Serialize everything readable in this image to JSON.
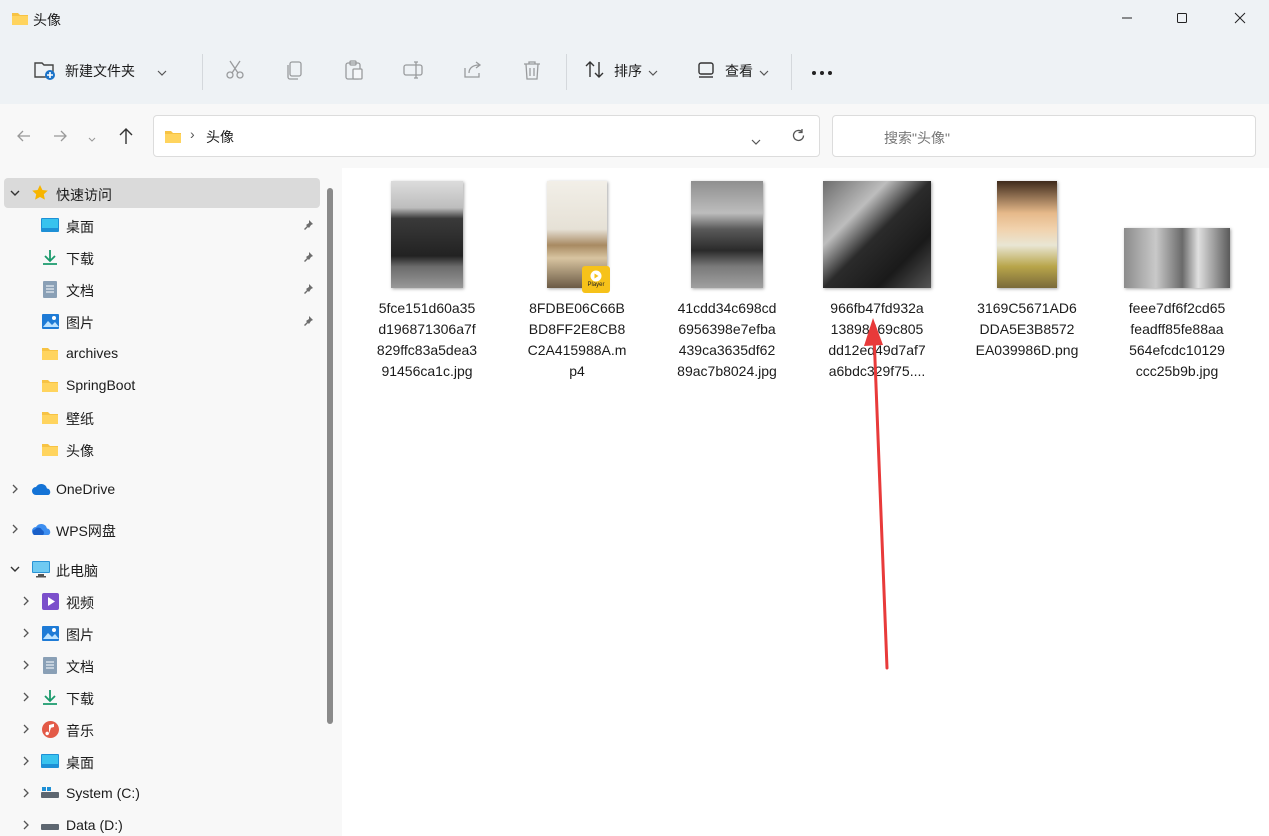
{
  "window": {
    "title": "头像",
    "controls": [
      "minimize",
      "maximize",
      "close"
    ]
  },
  "toolbar": {
    "new_folder_label": "新建文件夹",
    "sort_label": "排序",
    "view_label": "查看",
    "more_label": "•••"
  },
  "address": {
    "path": [
      "头像"
    ],
    "search_placeholder": "搜索\"头像\""
  },
  "sidebar": {
    "quick_access": {
      "label": "快速访问",
      "items": [
        {
          "label": "桌面",
          "icon": "desktop-icon",
          "pinned": true
        },
        {
          "label": "下载",
          "icon": "download-icon",
          "pinned": true
        },
        {
          "label": "文档",
          "icon": "document-icon",
          "pinned": true
        },
        {
          "label": "图片",
          "icon": "pictures-icon",
          "pinned": true
        },
        {
          "label": "archives",
          "icon": "folder-icon",
          "pinned": false
        },
        {
          "label": "SpringBoot",
          "icon": "folder-icon",
          "pinned": false
        },
        {
          "label": "壁纸",
          "icon": "folder-icon",
          "pinned": false
        },
        {
          "label": "头像",
          "icon": "folder-icon",
          "pinned": false
        }
      ]
    },
    "onedrive_label": "OneDrive",
    "wps_label": "WPS网盘",
    "this_pc": {
      "label": "此电脑",
      "items": [
        {
          "label": "视频",
          "icon": "video-icon"
        },
        {
          "label": "图片",
          "icon": "pictures-icon"
        },
        {
          "label": "文档",
          "icon": "document-icon"
        },
        {
          "label": "下载",
          "icon": "download-icon"
        },
        {
          "label": "音乐",
          "icon": "music-icon"
        },
        {
          "label": "桌面",
          "icon": "desktop-icon"
        },
        {
          "label": "System (C:)",
          "icon": "drive-c-icon"
        },
        {
          "label": "Data (D:)",
          "icon": "drive-d-icon"
        }
      ]
    }
  },
  "files": [
    {
      "name": "5fce151d60a35d196871306a7f829ffc83a5dea391456ca1c.jpg",
      "lines": [
        "5fce151d60a35",
        "d196871306a7f",
        "829ffc83a5dea3",
        "91456ca1c.jpg"
      ],
      "kind": "portrait-photo"
    },
    {
      "name": "8FDBE06C66BBD8FF2E8CB8C2A415988A.mp4",
      "lines": [
        "8FDBE06C66B",
        "BD8FF2E8CB8",
        "C2A415988A.m",
        "p4"
      ],
      "kind": "video",
      "badge": "Player"
    },
    {
      "name": "41cdd34c698cd6956398e7efba439ca3635df6289ac7b8024.jpg",
      "lines": [
        "41cdd34c698cd",
        "6956398e7efba",
        "439ca3635df62",
        "89ac7b8024.jpg"
      ],
      "kind": "portrait-photo"
    },
    {
      "name": "966fb47fd932a13898...",
      "lines": [
        "966fb47fd932a",
        "13898469c805",
        "dd12ed49d7af7",
        "a6bdc329f75...."
      ],
      "kind": "landscape-photo"
    },
    {
      "name": "3169C5671AD6DDA5E3B8572EA039986D.png",
      "lines": [
        "3169C5671AD6",
        "DDA5E3B8572",
        "EA039986D.png"
      ],
      "kind": "portrait-photo"
    },
    {
      "name": "feee7df6f2cd65feadff85fe88aa564efcdc10129ccc25b9b.jpg",
      "lines": [
        "feee7df6f2cd65",
        "feadff85fe88aa",
        "564efcdc10129",
        "ccc25b9b.jpg"
      ],
      "kind": "landscape-photo"
    }
  ],
  "annotation": {
    "type": "arrow",
    "color": "#e83a3a"
  }
}
